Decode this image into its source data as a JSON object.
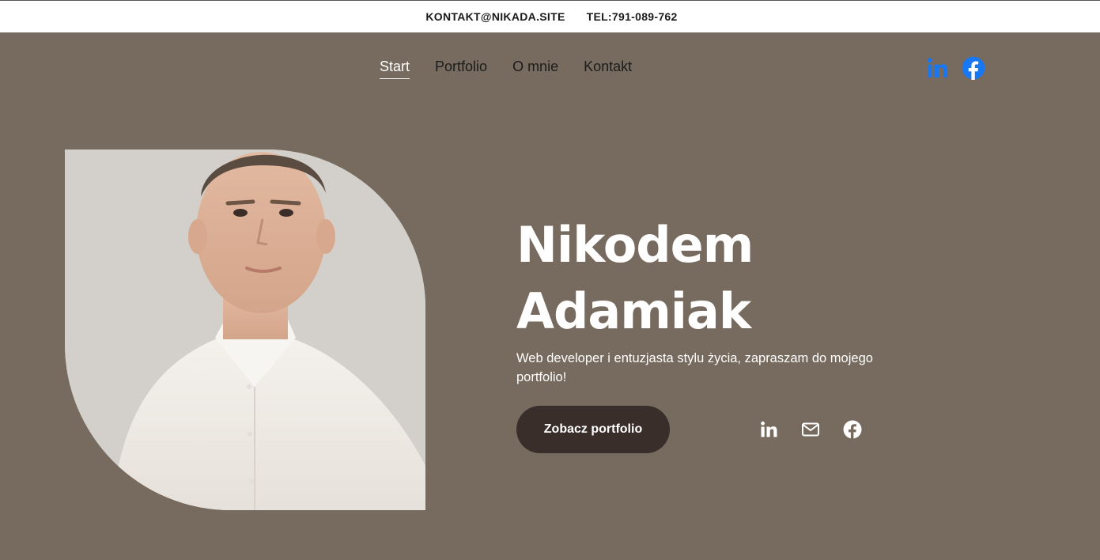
{
  "topbar": {
    "email": "KONTAKT@NIKADA.SITE",
    "phone": "TEL:791-089-762"
  },
  "nav": {
    "items": [
      {
        "label": "Start",
        "active": true
      },
      {
        "label": "Portfolio",
        "active": false
      },
      {
        "label": "O mnie",
        "active": false
      },
      {
        "label": "Kontakt",
        "active": false
      }
    ]
  },
  "header_social": [
    "linkedin-icon",
    "facebook-icon"
  ],
  "hero": {
    "name_line1": "Nikodem",
    "name_line2": "Adamiak",
    "tagline": "Web developer i entuzjasta stylu życia, zapraszam do mojego portfolio!",
    "cta_label": "Zobacz portfolio",
    "social": [
      "linkedin-icon",
      "mail-icon",
      "facebook-icon"
    ]
  },
  "colors": {
    "background": "#776a5e",
    "topbar": "#ffffff",
    "button": "#3a2e2a",
    "social_accent": "#1877f2"
  }
}
